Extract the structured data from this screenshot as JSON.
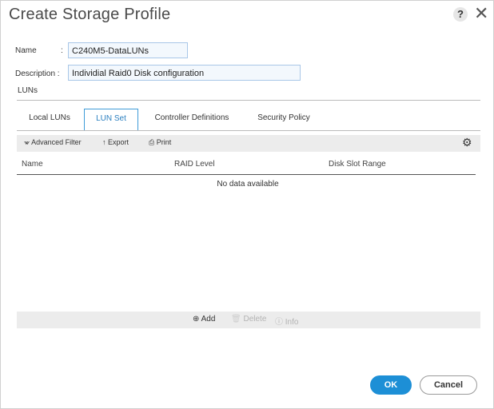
{
  "dialog": {
    "title": "Create Storage Profile",
    "help_symbol": "?",
    "close_symbol": "✕"
  },
  "form": {
    "name_label": "Name",
    "name_colon": ":",
    "name_value": "C240M5-DataLUNs",
    "description_label": "Description :",
    "description_value": "Individial Raid0 Disk configuration"
  },
  "section": {
    "title": "LUNs"
  },
  "tabs": [
    {
      "label": "Local LUNs"
    },
    {
      "label": "LUN Set",
      "active": true
    },
    {
      "label": "Controller Definitions"
    },
    {
      "label": "Security Policy"
    }
  ],
  "toolbar": {
    "filter_icon": "⩖",
    "filter_label": "Advanced Filter",
    "export_icon": "↑",
    "export_label": "Export",
    "print_icon": "⎙",
    "print_label": "Print",
    "gear_icon": "⚙"
  },
  "table": {
    "columns": [
      "Name",
      "RAID Level",
      "Disk Slot Range"
    ],
    "empty_text": "No data available"
  },
  "bottom": {
    "add_icon": "⊕",
    "add_label": "Add",
    "delete_icon": "🗑",
    "delete_label": "Delete",
    "info_icon": "ⓘ",
    "info_label": "Info"
  },
  "buttons": {
    "ok": "OK",
    "cancel": "Cancel"
  },
  "colors": {
    "accent": "#1d8fd6",
    "tab_active_border": "#3f9bd8",
    "input_border": "#a9c7e8"
  }
}
